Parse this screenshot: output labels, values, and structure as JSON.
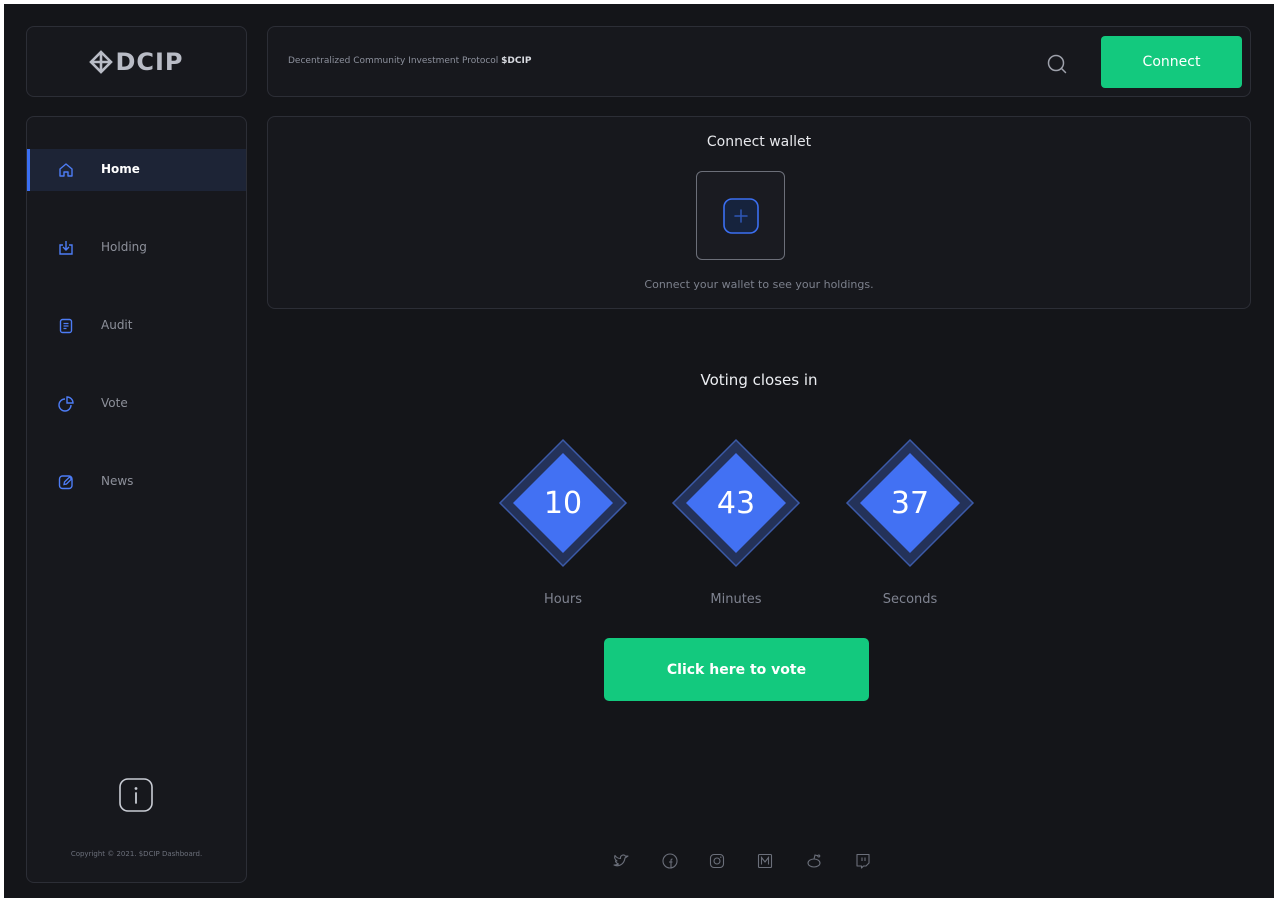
{
  "brand": {
    "logo_text": "DCIP"
  },
  "header": {
    "tagline": "Decentralized Community Investment Protocol",
    "tagline_bold": "$DCIP",
    "connect_label": "Connect"
  },
  "sidebar": {
    "items": [
      {
        "label": "Home",
        "icon": "home-icon",
        "active": true
      },
      {
        "label": "Holding",
        "icon": "download-icon",
        "active": false
      },
      {
        "label": "Audit",
        "icon": "document-icon",
        "active": false
      },
      {
        "label": "Vote",
        "icon": "pie-chart-icon",
        "active": false
      },
      {
        "label": "News",
        "icon": "edit-icon",
        "active": false
      }
    ],
    "copyright": "Copyright © 2021. $DCIP Dashboard."
  },
  "wallet": {
    "title": "Connect wallet",
    "subtitle": "Connect your wallet to see your holdings."
  },
  "voting": {
    "title": "Voting closes in",
    "hours": "10",
    "minutes": "43",
    "seconds": "37",
    "hours_label": "Hours",
    "minutes_label": "Minutes",
    "seconds_label": "Seconds",
    "button_label": "Click here to vote"
  },
  "colors": {
    "accent_green": "#13c97e",
    "accent_blue": "#3b6ff2",
    "background": "#141519"
  },
  "social": [
    "twitter-icon",
    "facebook-icon",
    "instagram-icon",
    "medium-icon",
    "reddit-icon",
    "twitch-icon"
  ]
}
